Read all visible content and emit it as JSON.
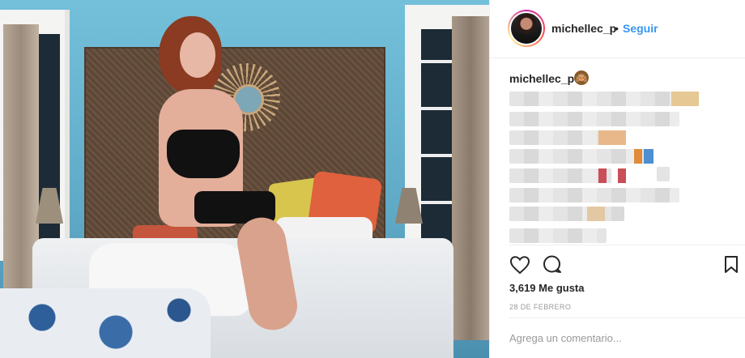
{
  "post": {
    "header": {
      "username": "michellec_p",
      "separator": "•",
      "follow_label": "Seguir"
    },
    "caption": {
      "username": "michellec_p",
      "emoji_icon": "monkey-emoji-icon"
    },
    "actions": {
      "like_icon": "heart-icon",
      "comment_icon": "comment-icon",
      "save_icon": "bookmark-icon"
    },
    "likes_text": "3,619 Me gusta",
    "date_text": "28 DE FEBRERO",
    "add_comment_placeholder": "Agrega un comentario..."
  },
  "colors": {
    "link_blue": "#3897f0",
    "text_dark": "#262626",
    "muted": "#999999"
  }
}
